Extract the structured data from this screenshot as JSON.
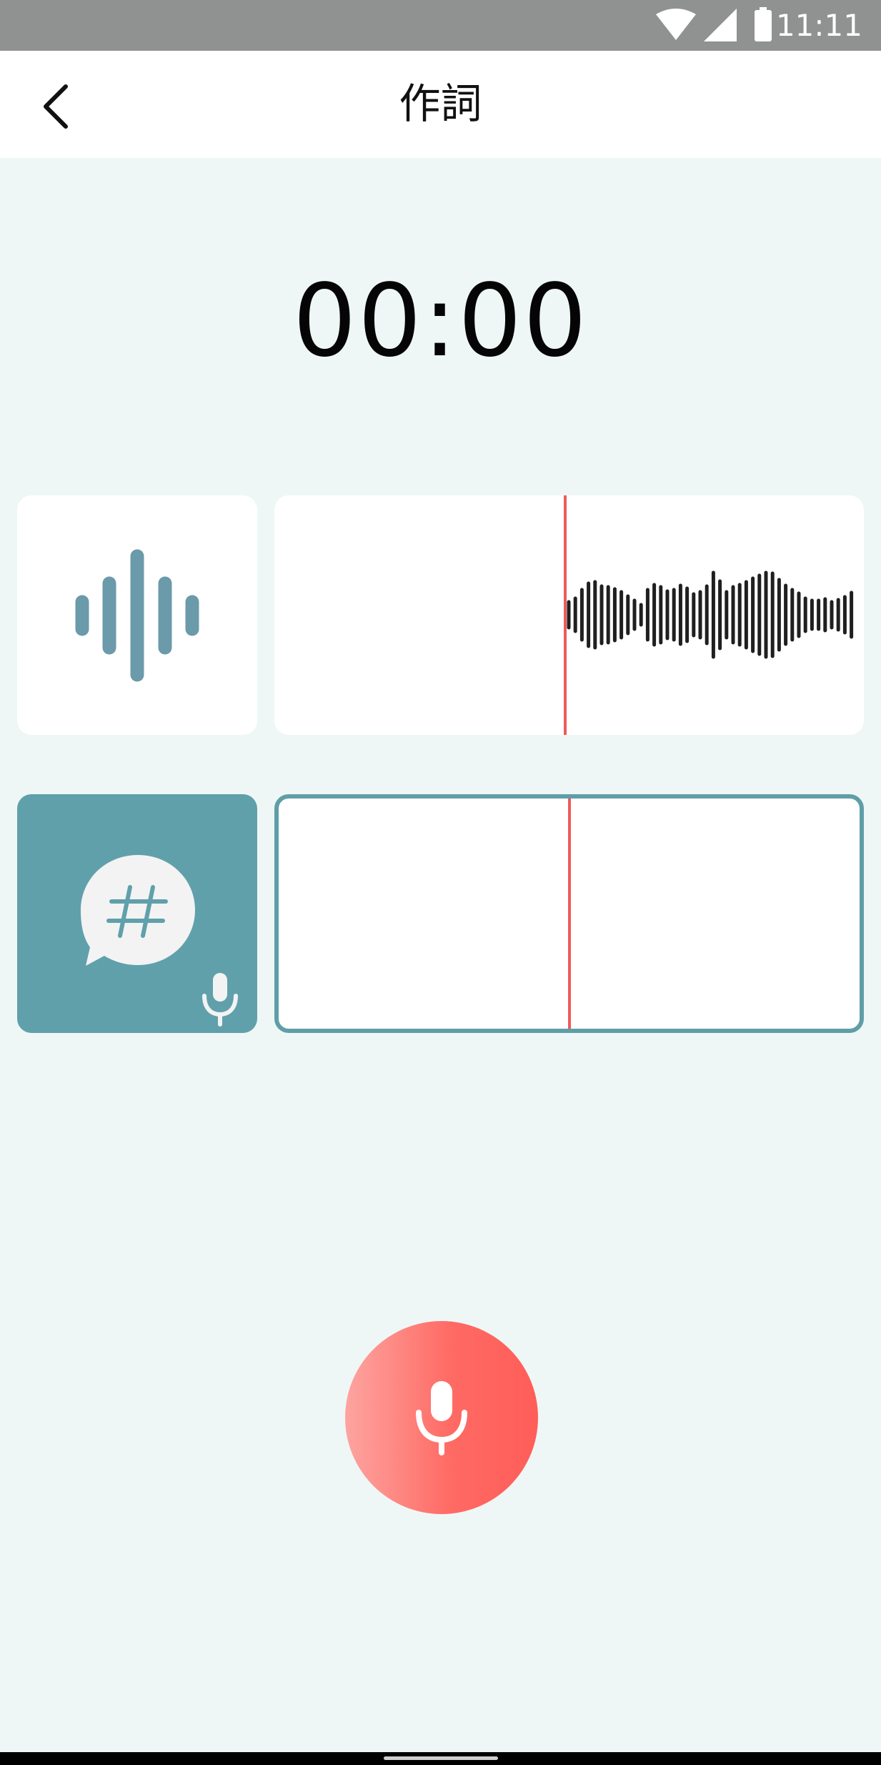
{
  "status_bar": {
    "time": "11:11",
    "icons": [
      "wifi-icon",
      "cellular-signal-icon",
      "battery-icon"
    ]
  },
  "app_bar": {
    "title": "作詞",
    "back_icon": "chevron-left-icon"
  },
  "timer": {
    "value": "00:00"
  },
  "tracks": {
    "audio_icon": "sound-wave-icon",
    "lyrics_icon": "hashtag-speech-bubble-icon",
    "lyrics_mic_icon": "microphone-icon"
  },
  "record_button": {
    "icon": "microphone-icon"
  },
  "colors": {
    "background": "#eff7f6",
    "accent_teal": "#60a0ab",
    "playhead_red": "#ef5a5a",
    "record_red": "#ff5d58"
  }
}
